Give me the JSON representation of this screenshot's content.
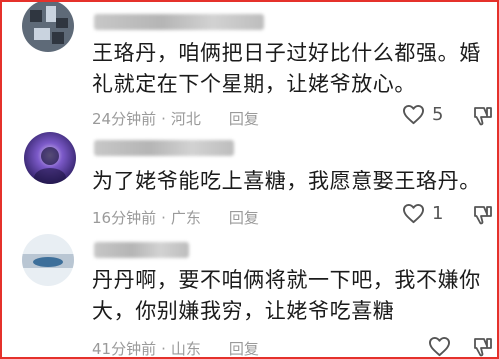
{
  "comments": [
    {
      "text": "王珞丹，咱俩把日子过好比什么都强。婚\n礼就定在下个星期，让姥爷放心。",
      "time": "24分钟前",
      "location": "河北",
      "reply_label": "回复",
      "likes": "5",
      "avatar_colors": [
        "#5e6a78",
        "#2f3640",
        "#c9d3df"
      ]
    },
    {
      "text": "为了姥爷能吃上喜糖，我愿意娶王珞丹。",
      "time": "16分钟前",
      "location": "广东",
      "reply_label": "回复",
      "likes": "1",
      "avatar_colors": [
        "#2a1c5e",
        "#7c5ac9",
        "#e6d6f5"
      ]
    },
    {
      "text": "丹丹啊，要不咱俩将就一下吧，我不嫌你\n大，你别嫌我穷，让姥爷吃喜糖",
      "time": "41分钟前",
      "location": "山东",
      "reply_label": "回复",
      "likes": "",
      "avatar_colors": [
        "#b9c6d3",
        "#3d6f9a",
        "#e8eef3"
      ]
    }
  ]
}
